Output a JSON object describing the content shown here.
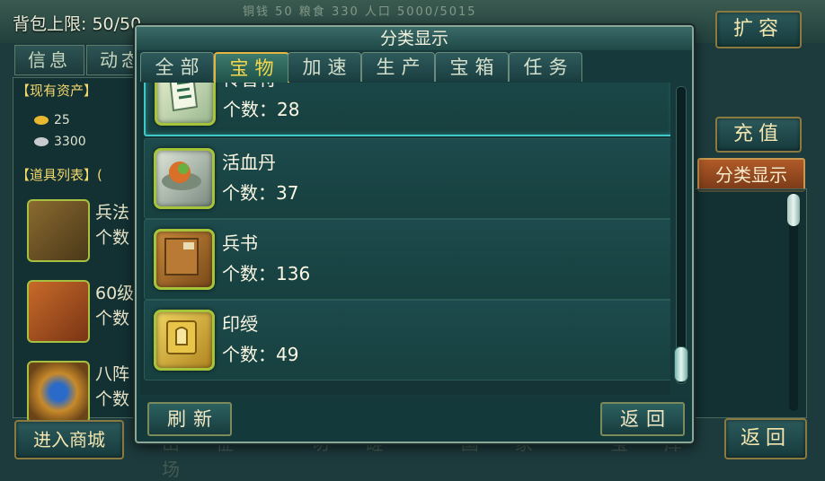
{
  "background": {
    "capacity_label": "背包上限: 50/50",
    "top_stats": "铜钱 50   粮食 330   人口 5000/5015",
    "expand_button": "扩容",
    "tabs": [
      "信息",
      "动态"
    ],
    "assets_section": "【现有资产】",
    "gold_amount": "25",
    "silver_amount": "3300",
    "items_section": "【道具列表】(",
    "left_items": [
      {
        "name": "兵法",
        "count": "个数"
      },
      {
        "name": "60级",
        "count": "个数"
      },
      {
        "name": "八阵",
        "count": "个数"
      }
    ],
    "recharge_button": "充值",
    "classify_button": "分类显示",
    "shop_button": "进入商城",
    "return_button": "返回",
    "bottom_nav": "出征 切磋 国家 宝库 战场"
  },
  "dialog": {
    "title": "分类显示",
    "tabs": [
      {
        "label": "全部",
        "active": false
      },
      {
        "label": "宝物",
        "active": true
      },
      {
        "label": "加速",
        "active": false
      },
      {
        "label": "生产",
        "active": false
      },
      {
        "label": "宝箱",
        "active": false
      },
      {
        "label": "任务",
        "active": false
      }
    ],
    "items": [
      {
        "name": "传音符",
        "count_label": "个数：28",
        "icon": "scroll-icon",
        "selected": true
      },
      {
        "name": "活血丹",
        "count_label": "个数：37",
        "icon": "pill-icon",
        "selected": false
      },
      {
        "name": "兵书",
        "count_label": "个数：136",
        "icon": "book-icon",
        "selected": false
      },
      {
        "name": "印绶",
        "count_label": "个数：49",
        "icon": "seal-icon",
        "selected": false
      }
    ],
    "refresh_button": "刷新",
    "back_button": "返回"
  },
  "colors": {
    "accent_gold": "#e2b640",
    "active_tab_text": "#f6d84a",
    "selected_border": "#3fc8c8",
    "icon_frame": "#a6c43a"
  }
}
